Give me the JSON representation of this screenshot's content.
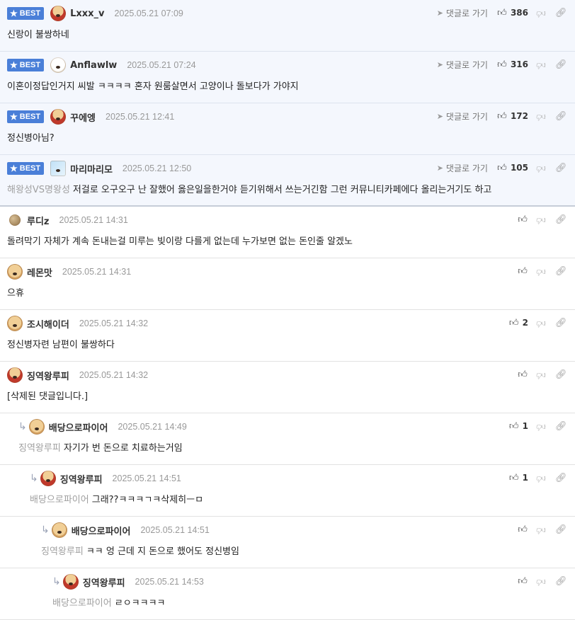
{
  "ui": {
    "best_label": "BEST",
    "goto_label": "댓글로 가기"
  },
  "comments": [
    {
      "best": true,
      "depth": 0,
      "avatar": "red",
      "nick": "Lxxx_v",
      "date": "2025.05.21 07:09",
      "body": "신랑이 불쌍하네",
      "mention": "",
      "likes": "386",
      "goto": true
    },
    {
      "best": true,
      "depth": 0,
      "avatar": "white",
      "nick": "Anflawlw",
      "date": "2025.05.21 07:24",
      "body": "이혼이정답인거지 씨발 ㅋㅋㅋㅋ 혼자 원룸살면서 고양이나 돌보다가 가야지",
      "mention": "",
      "likes": "316",
      "goto": true
    },
    {
      "best": true,
      "depth": 0,
      "avatar": "red",
      "nick": "꾸에엥",
      "date": "2025.05.21 12:41",
      "body": "정신병아님?",
      "mention": "",
      "likes": "172",
      "goto": true
    },
    {
      "best": true,
      "depth": 0,
      "avatar": "cube",
      "nick": "마리마리모",
      "date": "2025.05.21 12:50",
      "body": "저걸로 오구오구 난 잘했어 옳은일을한거야 듣기위해서 쓰는거긴함 그런 커뮤니티카페에다 올리는거기도 하고",
      "mention": "해왕성VS명왕성",
      "likes": "105",
      "goto": true
    },
    {
      "best": false,
      "depth": 0,
      "avatar": "ball",
      "nick": "루디z",
      "date": "2025.05.21 14:31",
      "body": "돌려막기 자체가 계속 돈내는걸 미루는 빚이랑 다를게 없는데 누가보면 없는 돈인줄 알겠노",
      "mention": "",
      "likes": "",
      "goto": false
    },
    {
      "best": false,
      "depth": 0,
      "avatar": "dog",
      "nick": "레몬맛",
      "date": "2025.05.21 14:31",
      "body": "으휴",
      "mention": "",
      "likes": "",
      "goto": false
    },
    {
      "best": false,
      "depth": 0,
      "avatar": "dog",
      "nick": "조시해이더",
      "date": "2025.05.21 14:32",
      "body": "정신병자련 남편이 불쌍하다",
      "mention": "",
      "likes": "2",
      "goto": false
    },
    {
      "best": false,
      "depth": 0,
      "avatar": "red",
      "nick": "징역왕루피",
      "date": "2025.05.21 14:32",
      "body": "[삭제된 댓글입니다.]",
      "mention": "",
      "likes": "",
      "goto": false
    },
    {
      "best": false,
      "depth": 1,
      "avatar": "dog",
      "nick": "배당으로파이어",
      "date": "2025.05.21 14:49",
      "body": "자기가 번 돈으로 치료하는거임",
      "mention": "징역왕루피",
      "likes": "1",
      "goto": false
    },
    {
      "best": false,
      "depth": 2,
      "avatar": "red",
      "nick": "징역왕루피",
      "date": "2025.05.21 14:51",
      "body": "그래??ㅋㅋㅋㄱㅋ삭제히ㅡㅁ",
      "mention": "배당으로파이어",
      "likes": "1",
      "goto": false
    },
    {
      "best": false,
      "depth": 3,
      "avatar": "dog",
      "nick": "배당으로파이어",
      "date": "2025.05.21 14:51",
      "body": "ㅋㅋ 엉 근데 지 돈으로 했어도 정신병임",
      "mention": "징역왕루피",
      "likes": "",
      "goto": false
    },
    {
      "best": false,
      "depth": 4,
      "avatar": "red",
      "nick": "징역왕루피",
      "date": "2025.05.21 14:53",
      "body": "ㄹㅇㅋㅋㅋㅋ",
      "mention": "배당으로파이어",
      "likes": "",
      "goto": false
    }
  ]
}
